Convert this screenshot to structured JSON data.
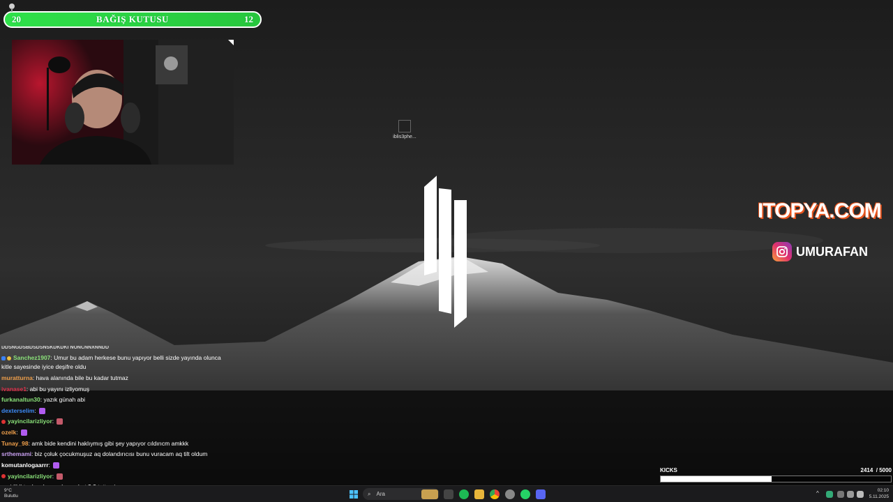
{
  "donation": {
    "left_value": "20",
    "title": "BAĞIŞ KUTUSU",
    "right_value": "12"
  },
  "desktop": {
    "icon_label": "iblis3phe..."
  },
  "sponsor": {
    "brand": "ITOPYA.COM",
    "instagram_handle": "UMURAFAN"
  },
  "chat": {
    "cut_line": "DDSNGDSBDSDSNSKDKDKI NONCNNXNNDD",
    "messages": [
      {
        "user": "Sanchez1907",
        "color": "#8be37a",
        "text": ": Umur bu adam herkese bunu yapıyor belli sizde yayında olunca kitle sayesinde iyice deşifre oldu",
        "badges": true
      },
      {
        "user": "muratturna",
        "color": "#f0a04b",
        "text": ": hava alanında bile bu kadar tutmaz"
      },
      {
        "user": "ivanase1",
        "color": "#e0314b",
        "text": ": abi bu yayını izliyomuş"
      },
      {
        "user": "furkanaltun30",
        "color": "#8be37a",
        "text": ": yazık günah abi"
      },
      {
        "user": "dexterselim",
        "color": "#3d8bf7",
        "text": ":",
        "emote": "#b15cf0"
      },
      {
        "user": "yayincilarizliyor",
        "color": "#8be37a",
        "text": ":",
        "emote": "#c45a6a",
        "badge": true
      },
      {
        "user": "ozelk",
        "color": "#f0a04b",
        "text": ":",
        "emote": "#b15cf0"
      },
      {
        "user": "Tunay_98",
        "color": "#f0a04b",
        "text": ": amk bide kendini haklıymış gibi şey yapıyor cıldırıcm amkkk"
      },
      {
        "user": "srthemami",
        "color": "#c8a0f0",
        "text": ": biz çoluk çocukmuşuz aq dolandırıcısı bunu vuracam aq tilt oldum"
      },
      {
        "user": "komutanlogaarrr",
        "color": "#ffffff",
        "text": ":",
        "emote": "#b15cf0"
      },
      {
        "user": "yayincilarizliyor",
        "color": "#8be37a",
        "text": ":",
        "emote": "#c45a6a",
        "badge": true
      }
    ],
    "partial_line": "na gidildi toplam her makan rahat 2 3 tuttu yine"
  },
  "kicks": {
    "label": "KICKS",
    "current": "2414",
    "goal": "/ 5000",
    "progress": 0.4828
  },
  "taskbar": {
    "search_placeholder": "Ara",
    "weather_line1": "9°C",
    "weather_line2": "Bulutlu",
    "time": "02:10",
    "date": "5.11.2025"
  },
  "icons": [
    "microphone-icon",
    "desktop-file-icon",
    "instagram-icon",
    "windows-start-icon",
    "search-icon",
    "task-view-icon",
    "spotify-icon",
    "file-explorer-icon",
    "chrome-icon",
    "settings-icon",
    "whatsapp-icon",
    "discord-icon",
    "wifi-icon",
    "volume-icon",
    "battery-icon"
  ]
}
